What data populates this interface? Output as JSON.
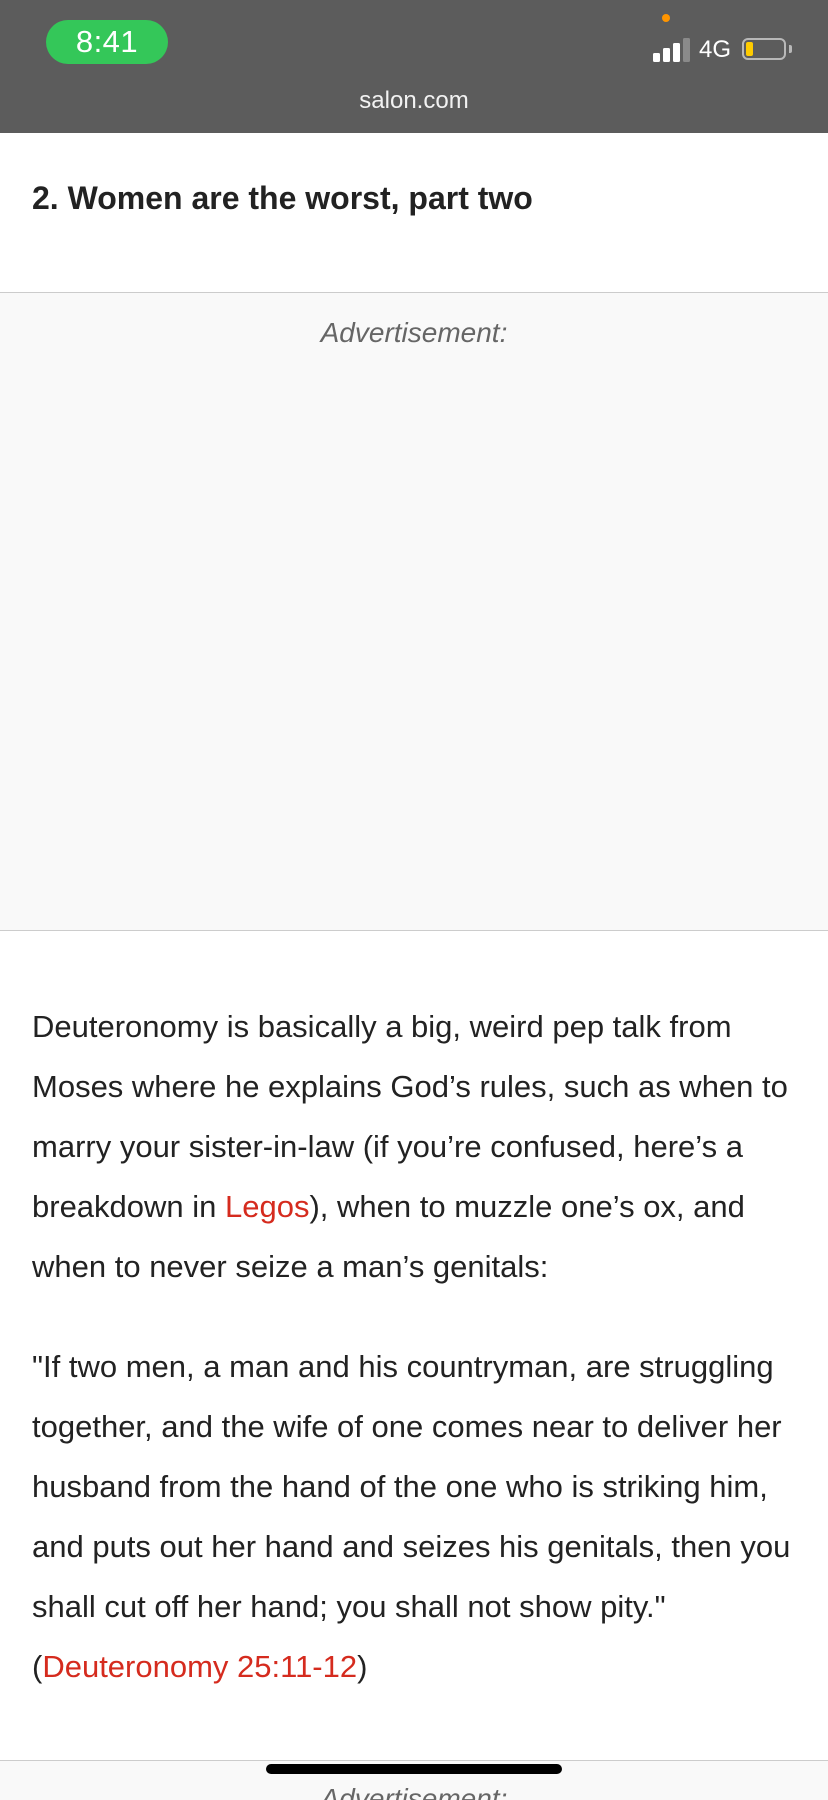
{
  "status_bar": {
    "time": "8:41",
    "network": "4G",
    "signal_bars": 3,
    "battery_level": 0.15,
    "time_pill_color": "#34c759",
    "battery_color": "#ffcc00",
    "privacy_dot_color": "#ff9500"
  },
  "browser": {
    "url": "salon.com"
  },
  "article": {
    "heading": "2. Women are the worst, part two",
    "ad_label": "Advertisement:",
    "paragraph1": {
      "before_link": "Deuteronomy is basically a big, weird pep talk from Moses where he explains God’s rules, such as when to marry your sister-in-law (if you’re confused, here’s a breakdown in ",
      "link_text": "Legos",
      "after_link": "), when to muzzle one’s ox, and when to never seize a man’s genitals:"
    },
    "paragraph2": {
      "before_link": "\"If two men, a man and his countryman, are struggling together, and the wife of one comes near to deliver her husband from the hand of the one who is striking him, and puts out her hand and seizes his genitals, then you shall cut off her hand; you shall not show pity.\" (",
      "link_text": "Deuteronomy 25:11-12",
      "after_link": ")"
    },
    "second_ad_label": "Advertisement:",
    "link_color": "#d52b1e"
  }
}
